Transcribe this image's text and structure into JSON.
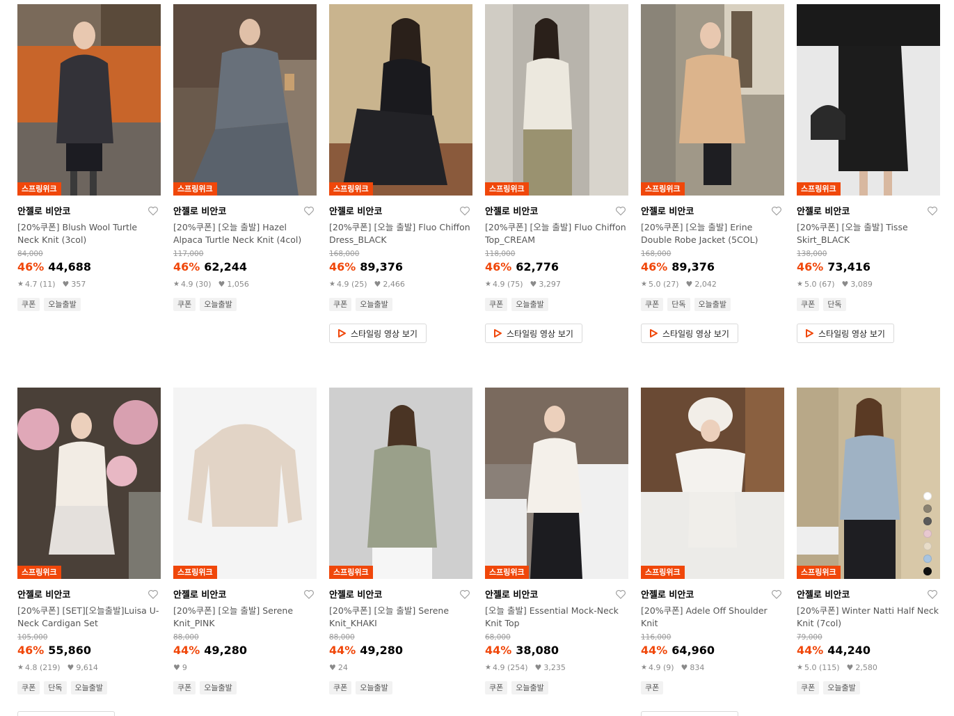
{
  "row1": [
    {
      "badge": "스프링위크",
      "brand": "안젤로 비안코",
      "title": "[20%쿠폰] Blush Wool Turtle Neck Knit (3col)",
      "original_price": "84,000",
      "discount": "46%",
      "price": "44,688",
      "rating": "4.7 (11)",
      "likes": "357",
      "tags": [
        "쿠폰",
        "오늘출발"
      ],
      "video_label": ""
    },
    {
      "badge": "스프링위크",
      "brand": "안젤로 비안코",
      "title": "[20%쿠폰] [오늘 출발] Hazel Alpaca Turtle Neck Knit (4col)",
      "original_price": "117,000",
      "discount": "46%",
      "price": "62,244",
      "rating": "4.9 (30)",
      "likes": "1,056",
      "tags": [
        "쿠폰",
        "오늘출발"
      ],
      "video_label": ""
    },
    {
      "badge": "스프링위크",
      "brand": "안젤로 비안코",
      "title": "[20%쿠폰] [오늘 출발] Fluo Chiffon Dress_BLACK",
      "original_price": "168,000",
      "discount": "46%",
      "price": "89,376",
      "rating": "4.9 (25)",
      "likes": "2,466",
      "tags": [
        "쿠폰",
        "오늘출발"
      ],
      "video_label": "스타일링 영상 보기"
    },
    {
      "badge": "스프링위크",
      "brand": "안젤로 비안코",
      "title": "[20%쿠폰] [오늘 출발] Fluo Chiffon Top_CREAM",
      "original_price": "118,000",
      "discount": "46%",
      "price": "62,776",
      "rating": "4.9 (75)",
      "likes": "3,297",
      "tags": [
        "쿠폰",
        "오늘출발"
      ],
      "video_label": "스타일링 영상 보기"
    },
    {
      "badge": "스프링위크",
      "brand": "안젤로 비안코",
      "title": "[20%쿠폰] [오늘 출발] Erine Double Robe Jacket (5COL)",
      "original_price": "168,000",
      "discount": "46%",
      "price": "89,376",
      "rating": "5.0 (27)",
      "likes": "2,042",
      "tags": [
        "쿠폰",
        "단독",
        "오늘출발"
      ],
      "video_label": "스타일링 영상 보기"
    },
    {
      "badge": "스프링위크",
      "brand": "안젤로 비안코",
      "title": "[20%쿠폰] [오늘 출발] Tisse Skirt_BLACK",
      "original_price": "138,000",
      "discount": "46%",
      "price": "73,416",
      "rating": "5.0 (67)",
      "likes": "3,089",
      "tags": [
        "쿠폰",
        "단독"
      ],
      "video_label": "스타일링 영상 보기"
    }
  ],
  "row2": [
    {
      "badge": "스프링위크",
      "brand": "안젤로 비안코",
      "title": "[20%쿠폰] [SET][오늘출발]Luisa U-Neck Cardigan Set",
      "original_price": "105,000",
      "discount": "46%",
      "price": "55,860",
      "rating": "4.8 (219)",
      "likes": "9,614",
      "tags": [
        "쿠폰",
        "단독",
        "오늘출발"
      ]
    },
    {
      "badge": "스프링위크",
      "brand": "안젤로 비안코",
      "title": "[20%쿠폰] [오늘 출발] Serene Knit_PINK",
      "original_price": "88,000",
      "discount": "44%",
      "price": "49,280",
      "rating": "",
      "likes": "9",
      "tags": [
        "쿠폰",
        "오늘출발"
      ]
    },
    {
      "badge": "스프링위크",
      "brand": "안젤로 비안코",
      "title": "[20%쿠폰] [오늘 출발] Serene Knit_KHAKI",
      "original_price": "88,000",
      "discount": "44%",
      "price": "49,280",
      "rating": "",
      "likes": "24",
      "tags": [
        "쿠폰",
        "오늘출발"
      ]
    },
    {
      "badge": "스프링위크",
      "brand": "안젤로 비안코",
      "title": "[오늘 출발] Essential Mock-Neck Knit Top",
      "original_price": "68,000",
      "discount": "44%",
      "price": "38,080",
      "rating": "4.9 (254)",
      "likes": "3,235",
      "tags": [
        "쿠폰",
        "오늘출발"
      ]
    },
    {
      "badge": "스프링위크",
      "brand": "안젤로 비안코",
      "title": "[20%쿠폰] Adele Off Shoulder Knit",
      "original_price": "116,000",
      "discount": "44%",
      "price": "64,960",
      "rating": "4.9 (9)",
      "likes": "834",
      "tags": [
        "쿠폰"
      ]
    },
    {
      "badge": "스프링위크",
      "brand": "안젤로 비안코",
      "title": "[20%쿠폰] Winter Natti Half Neck Knit (7col)",
      "original_price": "79,000",
      "discount": "44%",
      "price": "44,240",
      "rating": "5.0 (115)",
      "likes": "2,580",
      "tags": [
        "쿠폰",
        "오늘출발"
      ]
    }
  ],
  "swatch_colors": [
    "#ffffff",
    "#8a8272",
    "#5a5a5a",
    "#e8c8d0",
    "#e8dcc8",
    "#a8c4e0",
    "#111111"
  ],
  "colors": {
    "accent": "#f0470a",
    "muted": "#8a8a8a"
  },
  "icons": {
    "wish": "heart-outline-icon",
    "rating": "star-icon",
    "likes": "heart-filled-icon",
    "video": "play-icon"
  }
}
